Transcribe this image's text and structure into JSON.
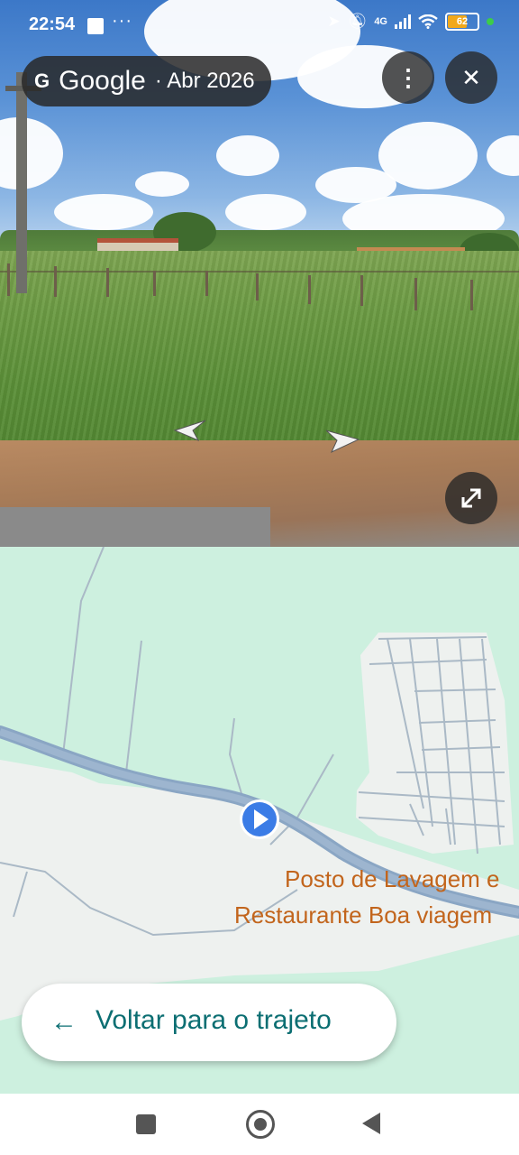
{
  "status_bar": {
    "time": "22:54",
    "dots": "···",
    "network": "4G",
    "battery": "62",
    "battery_level": 0.62
  },
  "street_view": {
    "provider": "Google",
    "date": "· Abr 2026",
    "icons": [
      "more-vert-icon",
      "close-icon",
      "fullscreen-icon",
      "arrow-left-icon",
      "arrow-right-icon"
    ]
  },
  "map": {
    "place_label_line1": "Posto de Lavagem e",
    "place_label_line2": "Restaurante Boa viagem",
    "back_button_label": "Voltar para o trajeto",
    "colors": {
      "land": "#cdf0df",
      "road": "#8aa6c4",
      "area": "#eef1ef",
      "place_text": "#c2651c",
      "accent": "#0b6e72"
    }
  },
  "navbar": {
    "icons": [
      "recents-icon",
      "home-icon",
      "back-icon"
    ]
  }
}
